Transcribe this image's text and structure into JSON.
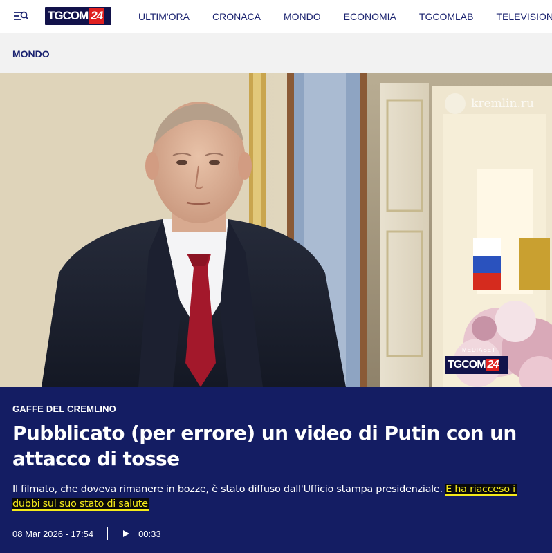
{
  "header": {
    "logo": {
      "part1": "TG",
      "part2": "COM",
      "part3": "24"
    },
    "nav": [
      "ULTIM'ORA",
      "CRONACA",
      "MONDO",
      "ECONOMIA",
      "TGCOMLAB",
      "TELEVISIONE"
    ]
  },
  "section": {
    "label": "MONDO"
  },
  "hero": {
    "watermark": "kremlin.ru",
    "brand": {
      "mediaset": "MEDIASET",
      "part1": "TG",
      "part2": "COM",
      "part3": "24"
    }
  },
  "article": {
    "kicker": "GAFFE DEL CREMLINO",
    "headline": "Pubblicato (per errore) un video di Putin con un attacco di tosse",
    "summary_plain": "Il filmato, che doveva rimanere in bozze, è stato diffuso dall'Ufficio stampa presidenziale. ",
    "summary_highlight_1": "E ha riacceso i",
    "summary_highlight_2": "dubbi sul suo stato di salute",
    "date": "08 Mar 2026 - 17:54",
    "duration": "00:33"
  },
  "colors": {
    "brand_navy": "#141d63",
    "logo_red": "#e02020",
    "highlight_yellow": "#f5ea1a",
    "section_bg": "#f2f2f2"
  },
  "icons": {
    "menu": "menu-search-icon",
    "play": "play-icon"
  }
}
